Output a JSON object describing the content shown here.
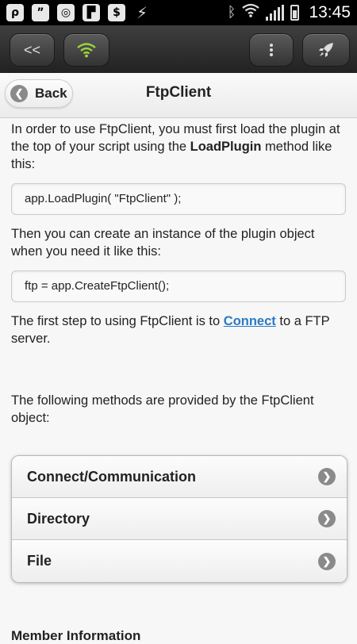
{
  "status_bar": {
    "time": "13:45",
    "left_icons": [
      "p-app-icon",
      "chat-icon",
      "sync-icon",
      "flipboard-icon",
      "dollar-icon",
      "bolt-icon"
    ],
    "right_icons": [
      "bluetooth-icon",
      "wifi-icon",
      "signal-icon",
      "battery-icon"
    ]
  },
  "toolbar": {
    "back_label": "<<",
    "wifi_icon": "wifi-icon",
    "menu_icon": "more-vertical-icon",
    "rocket_icon": "rocket-icon",
    "wifi_color": "#9bd53b"
  },
  "header": {
    "back_label": "Back",
    "title": "FtpClient"
  },
  "content": {
    "p1_a": "In order to use FtpClient, you must first load the plugin at the top of your script using the ",
    "p1_bold": "LoadPlugin",
    "p1_b": " method like this:",
    "code1": "app.LoadPlugin( \"FtpClient\" );",
    "p2": "Then you can create an instance of the plugin object when you need it like this:",
    "code2": "ftp = app.CreateFtpClient();",
    "p3_a": "The first step to using FtpClient is to ",
    "p3_link": "Connect",
    "p3_b": " to a FTP server.",
    "p4": "The following methods are provided by the FtpClient object:"
  },
  "methods": {
    "items": [
      {
        "label": "Connect/Communication"
      },
      {
        "label": "Directory"
      },
      {
        "label": "File"
      }
    ]
  },
  "footer_partial": "Member Information"
}
